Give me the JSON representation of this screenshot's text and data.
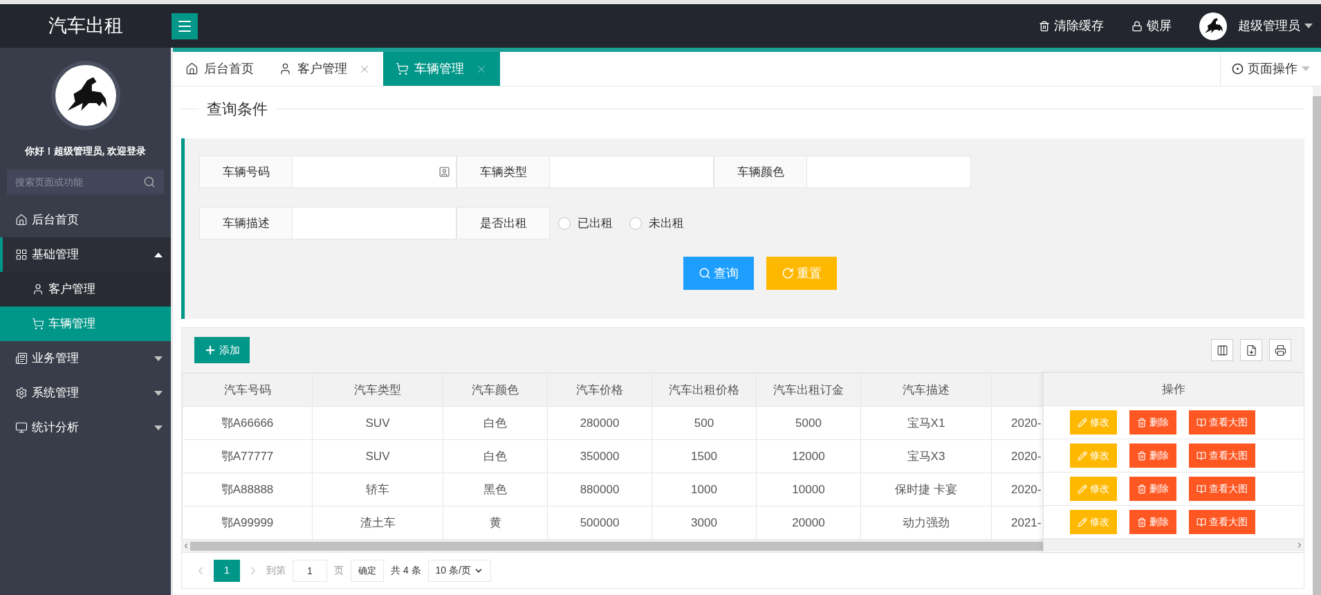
{
  "header": {
    "title": "汽车出租",
    "actions": [
      {
        "kind": "clear",
        "label": "清除缓存"
      },
      {
        "kind": "lock",
        "label": "锁屏"
      }
    ],
    "user": "超级管理员"
  },
  "sidebar": {
    "greeting": "你好！超级管理员, 欢迎登录",
    "search": {
      "placeholder": "搜索页面或功能"
    },
    "items": [
      {
        "kind": "home",
        "label": "后台首页",
        "selected": false
      },
      {
        "kind": "basic",
        "label": "基础管理",
        "selected": false,
        "expanded": true,
        "children": [
          {
            "kind": "user",
            "label": "客户管理",
            "selected": false
          },
          {
            "kind": "cart",
            "label": "车辆管理",
            "selected": true
          }
        ]
      },
      {
        "kind": "business",
        "label": "业务管理",
        "selected": false,
        "expanded": false
      },
      {
        "kind": "system",
        "label": "系统管理",
        "selected": false,
        "expanded": false
      },
      {
        "kind": "stats",
        "label": "统计分析",
        "selected": false,
        "expanded": false
      }
    ]
  },
  "tabs": [
    {
      "kind": "home",
      "label": "后台首页",
      "selected": false,
      "closable": false
    },
    {
      "kind": "user",
      "label": "客户管理",
      "selected": false,
      "closable": true
    },
    {
      "kind": "cart",
      "label": "车辆管理",
      "selected": true,
      "closable": true
    }
  ],
  "page_ops": "页面操作",
  "query": {
    "title": "查询条件",
    "fields": [
      {
        "kind": "input",
        "label": "车辆号码",
        "icon": true
      },
      {
        "kind": "input",
        "label": "车辆类型",
        "icon": false
      },
      {
        "kind": "input",
        "label": "车辆颜色",
        "icon": false
      },
      {
        "kind": "input",
        "label": "车辆描述",
        "icon": false
      },
      {
        "kind": "radio",
        "label": "是否出租",
        "options": [
          {
            "label": "已出租",
            "selected": false
          },
          {
            "label": "未出租",
            "selected": false
          }
        ]
      }
    ],
    "buttons": [
      {
        "kind": "search",
        "label": "查询"
      },
      {
        "kind": "reset",
        "label": "重置"
      }
    ]
  },
  "table": {
    "add_button": "添加",
    "columns": [
      "汽车号码",
      "汽车类型",
      "汽车颜色",
      "汽车价格",
      "汽车出租价格",
      "汽车出租订金",
      "汽车描述"
    ],
    "action_column": "操作",
    "rows": [
      {
        "cells": [
          "鄂A66666",
          "SUV",
          "白色",
          "280000",
          "500",
          "5000",
          "宝马X1",
          "2020-"
        ],
        "actions": [
          {
            "kind": "edit",
            "label": "修改"
          },
          {
            "kind": "delete",
            "label": "删除"
          },
          {
            "kind": "view",
            "label": "查看大图"
          }
        ]
      },
      {
        "cells": [
          "鄂A77777",
          "SUV",
          "白色",
          "350000",
          "1500",
          "12000",
          "宝马X3",
          "2020-"
        ],
        "actions": [
          {
            "kind": "edit",
            "label": "修改"
          },
          {
            "kind": "delete",
            "label": "删除"
          },
          {
            "kind": "view",
            "label": "查看大图"
          }
        ]
      },
      {
        "cells": [
          "鄂A88888",
          "轿车",
          "黑色",
          "880000",
          "1000",
          "10000",
          "保时捷 卡宴",
          "2020-"
        ],
        "actions": [
          {
            "kind": "edit",
            "label": "修改"
          },
          {
            "kind": "delete",
            "label": "删除"
          },
          {
            "kind": "view",
            "label": "查看大图"
          }
        ]
      },
      {
        "cells": [
          "鄂A99999",
          "渣土车",
          "黄",
          "500000",
          "3000",
          "20000",
          "动力强劲",
          "2021-"
        ],
        "actions": [
          {
            "kind": "edit",
            "label": "修改"
          },
          {
            "kind": "delete",
            "label": "删除"
          },
          {
            "kind": "view",
            "label": "查看大图"
          }
        ]
      }
    ]
  },
  "pager": {
    "pages": [
      {
        "label": "1",
        "selected": true
      }
    ],
    "goto": "到第",
    "page_input": "1",
    "page_unit": "页",
    "confirm": "确定",
    "total": "共 4 条",
    "page_size": "10 条/页"
  }
}
